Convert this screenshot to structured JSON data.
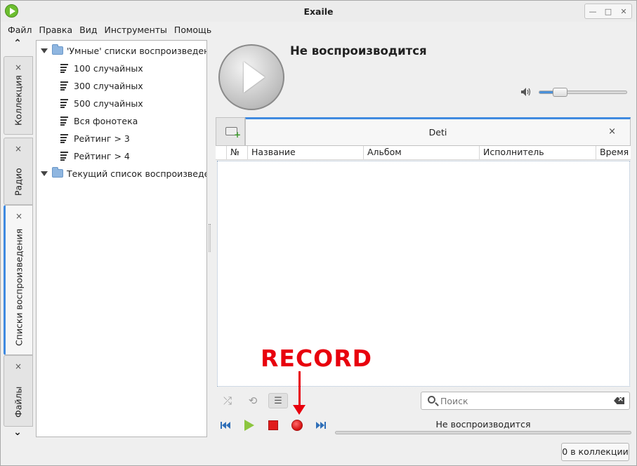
{
  "window": {
    "title": "Exaile"
  },
  "menu": [
    "Файл",
    "Правка",
    "Вид",
    "Инструменты",
    "Помощь"
  ],
  "side_tabs": [
    {
      "label": "Коллекция",
      "close": "×"
    },
    {
      "label": "Радио",
      "close": "×"
    },
    {
      "label": "Списки воспроизведения",
      "close": "×",
      "active": true
    },
    {
      "label": "Файлы",
      "close": "×"
    }
  ],
  "tree": {
    "groups": [
      {
        "label": "'Умные' списки воспроизведения",
        "items": [
          "100 случайных",
          "300 случайных",
          "500 случайных",
          "Вся фонотека",
          "Рейтинг > 3",
          "Рейтинг > 4"
        ]
      },
      {
        "label": "Текущий список воспроизведения",
        "items": []
      }
    ]
  },
  "now_playing": {
    "title": "Не воспроизводится",
    "volume": 0.24
  },
  "playlist": {
    "tab_name": "Deti",
    "tab_close": "×",
    "columns": [
      "№",
      "Название",
      "Альбом",
      "Исполнитель",
      "Время"
    ],
    "rows": []
  },
  "search": {
    "placeholder": "Поиск",
    "value": ""
  },
  "playback": {
    "status": "Не воспроизводится",
    "progress": 0
  },
  "annotation": {
    "text": "RECORD",
    "color": "#e8000d"
  },
  "statusbar": {
    "count": "0 в коллекции"
  },
  "colors": {
    "accent": "#3f8ae0",
    "record": "#e01c1c",
    "play": "#8cc63f",
    "nav": "#2f6fb8"
  }
}
